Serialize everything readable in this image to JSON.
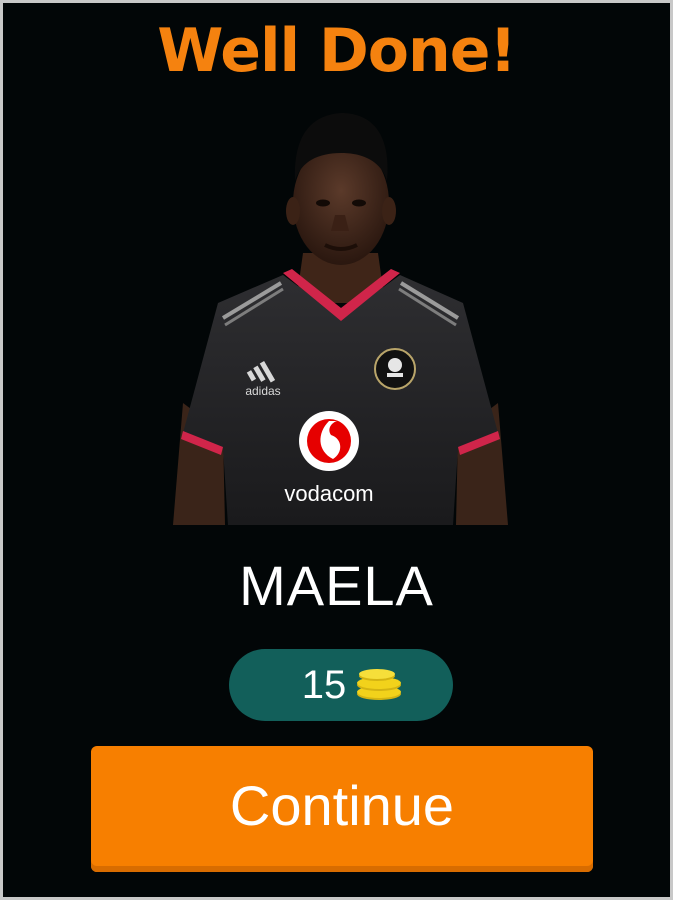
{
  "result": {
    "title": "Well Done!"
  },
  "player": {
    "name": "MAELA",
    "shirt_sponsor": "vodacom",
    "kit_brand": "adidas"
  },
  "reward": {
    "coins": "15",
    "icon": "coin-stack-icon"
  },
  "actions": {
    "continue_label": "Continue"
  },
  "colors": {
    "background": "#020607",
    "title": "#f5820f",
    "pill": "#125f5a",
    "coin": "#f2d21b",
    "button": "#f77f00"
  }
}
